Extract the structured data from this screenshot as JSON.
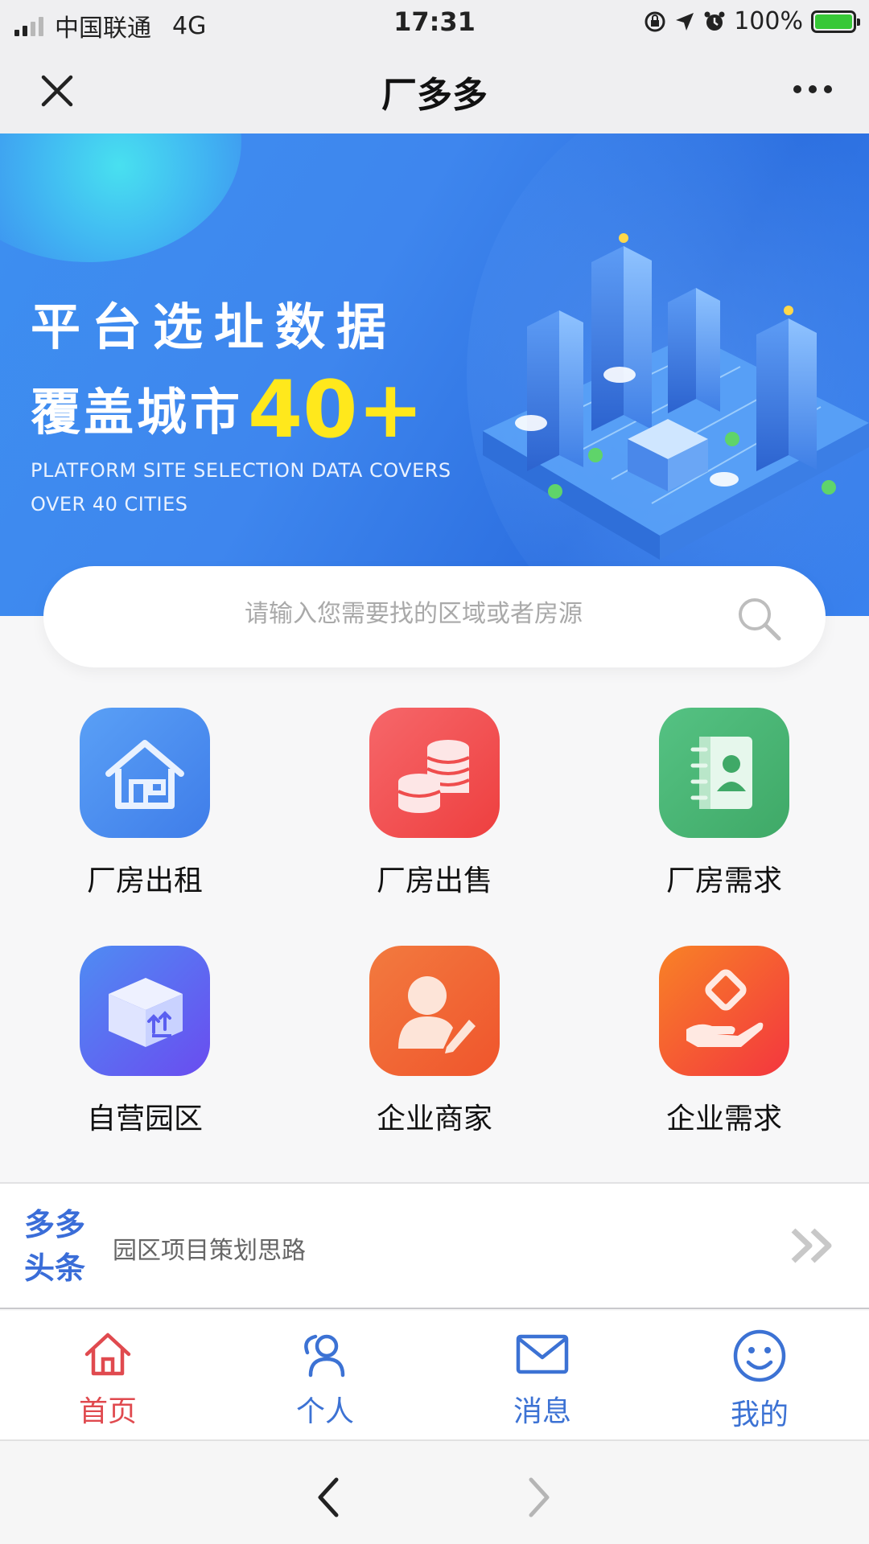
{
  "status_bar": {
    "carrier": "中国联通",
    "network": "4G",
    "time": "17:31",
    "battery": "100%"
  },
  "nav": {
    "title": "厂多多",
    "close_icon": "close-icon",
    "more_icon": "more-icon"
  },
  "banner": {
    "line1": "平台选址数据",
    "line2_prefix": "覆盖城市",
    "line2_highlight": "40+",
    "subtitle_line1": "PLATFORM SITE SELECTION DATA COVERS",
    "subtitle_line2": "OVER 40 CITIES"
  },
  "search": {
    "placeholder": "请输入您需要找的区域或者房源",
    "icon": "search-icon"
  },
  "grid": [
    {
      "label": "厂房出租",
      "icon": "house-icon",
      "color": "#4a8ff2"
    },
    {
      "label": "厂房出售",
      "icon": "coins-icon",
      "color": "#f2514f"
    },
    {
      "label": "厂房需求",
      "icon": "contact-book-icon",
      "color": "#45b574"
    },
    {
      "label": "自营园区",
      "icon": "package-box-icon",
      "color": "#5a6ff5"
    },
    {
      "label": "企业商家",
      "icon": "user-edit-icon",
      "color": "#f46a34"
    },
    {
      "label": "企业需求",
      "icon": "hand-money-icon",
      "color": "#f54a37"
    }
  ],
  "news": {
    "logo_line1": "多多",
    "logo_line2": "头条",
    "headline": "园区项目策划思路",
    "arrow_icon": "double-chevron-right-icon"
  },
  "tabbar": [
    {
      "label": "首页",
      "icon": "home-icon",
      "active": true
    },
    {
      "label": "个人",
      "icon": "person-icon",
      "active": false
    },
    {
      "label": "消息",
      "icon": "mail-icon",
      "active": false
    },
    {
      "label": "我的",
      "icon": "smiley-icon",
      "active": false
    }
  ],
  "colors": {
    "tab_active": "#e04a4f",
    "tab_inactive": "#3c72d4",
    "banner_highlight": "#ffe81c"
  }
}
